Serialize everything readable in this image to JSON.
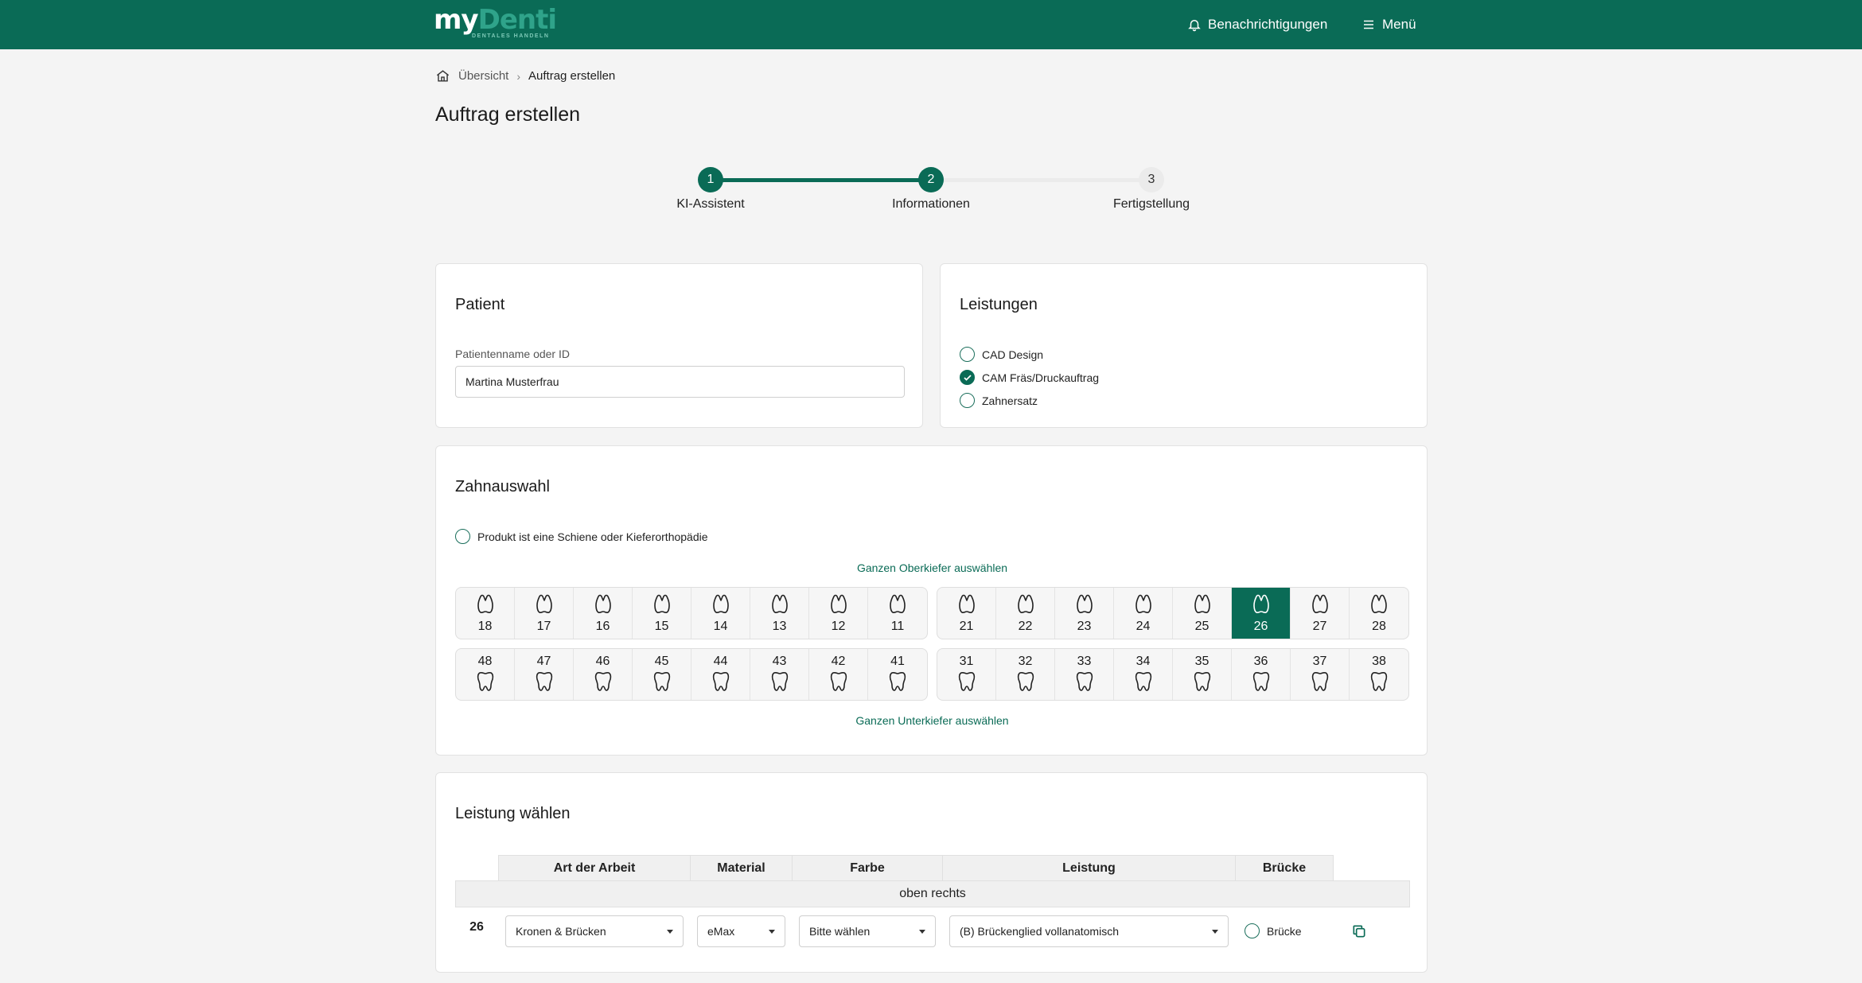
{
  "header": {
    "logo_prefix": "my",
    "logo_brand": "Denti",
    "logo_tagline": "DENTALES HANDELN",
    "notifications_label": "Benachrichtigungen",
    "menu_label": "Menü"
  },
  "breadcrumb": {
    "home": "Übersicht",
    "current": "Auftrag erstellen"
  },
  "page_title": "Auftrag erstellen",
  "stepper": {
    "steps": [
      {
        "number": "1",
        "label": "KI-Assistent",
        "state": "done"
      },
      {
        "number": "2",
        "label": "Informationen",
        "state": "active"
      },
      {
        "number": "3",
        "label": "Fertigstellung",
        "state": "upcoming"
      }
    ]
  },
  "patient": {
    "title": "Patient",
    "field_label": "Patientenname oder ID",
    "value": "Martina Musterfrau"
  },
  "services": {
    "title": "Leistungen",
    "options": [
      {
        "label": "CAD Design",
        "checked": false
      },
      {
        "label": "CAM Fräs/Druckauftrag",
        "checked": true
      },
      {
        "label": "Zahnersatz",
        "checked": false
      }
    ]
  },
  "teeth": {
    "title": "Zahnauswahl",
    "splint_label": "Produkt ist eine Schiene oder Kieferorthopädie",
    "select_upper": "Ganzen Oberkiefer auswählen",
    "select_lower": "Ganzen Unterkiefer auswählen",
    "upper_right": [
      "18",
      "17",
      "16",
      "15",
      "14",
      "13",
      "12",
      "11"
    ],
    "upper_left": [
      "21",
      "22",
      "23",
      "24",
      "25",
      "26",
      "27",
      "28"
    ],
    "lower_right": [
      "48",
      "47",
      "46",
      "45",
      "44",
      "43",
      "42",
      "41"
    ],
    "lower_left": [
      "31",
      "32",
      "33",
      "34",
      "35",
      "36",
      "37",
      "38"
    ],
    "selected": [
      "26"
    ]
  },
  "service_table": {
    "title": "Leistung wählen",
    "headers": [
      "Art der Arbeit",
      "Material",
      "Farbe",
      "Leistung",
      "Brücke"
    ],
    "group_label": "oben rechts",
    "rows": [
      {
        "tooth": "26",
        "work_type": "Kronen & Brücken",
        "material": "eMax",
        "color": "Bitte wählen",
        "service": "(B) Brückenglied vollanatomisch",
        "bridge_label": "Brücke",
        "bridge_checked": false
      }
    ]
  },
  "colors": {
    "primary": "#0a6b56",
    "background": "#f4f4f4"
  },
  "icons": {
    "home": "home-icon",
    "bell": "bell-icon",
    "menu": "hamburger-icon",
    "copy": "copy-icon",
    "tooth_upper": "upper-tooth-icon",
    "tooth_lower": "lower-tooth-icon"
  }
}
